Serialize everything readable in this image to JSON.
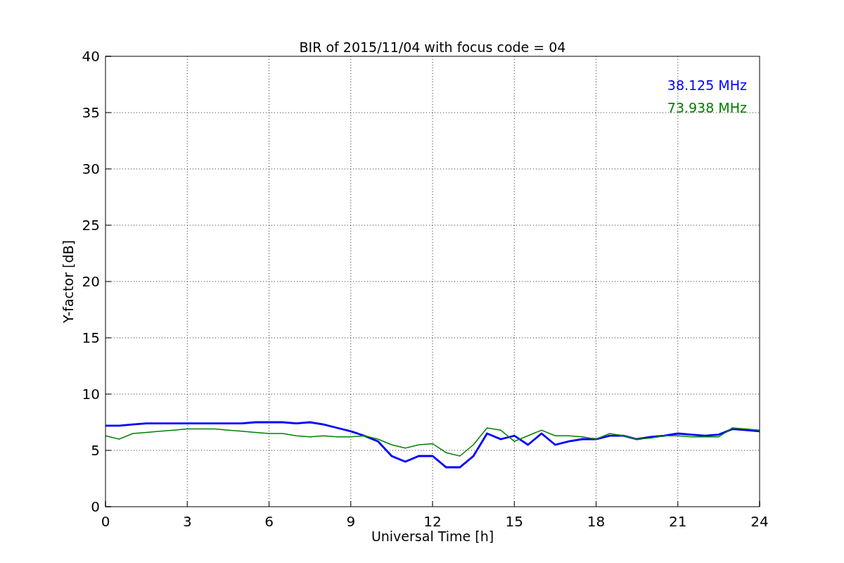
{
  "chart_data": {
    "type": "line",
    "title": "BIR of 2015/11/04 with focus code = 04",
    "xlabel": "Universal Time [h]",
    "ylabel": "Y-factor [dB]",
    "x": [
      0,
      0.5,
      1,
      1.5,
      2,
      2.5,
      3,
      3.5,
      4,
      4.5,
      5,
      5.5,
      6,
      6.5,
      7,
      7.5,
      8,
      8.5,
      9,
      9.5,
      10,
      10.5,
      11,
      11.5,
      12,
      12.5,
      13,
      13.5,
      14,
      14.5,
      15,
      15.5,
      16,
      16.5,
      17,
      17.5,
      18,
      18.5,
      19,
      19.5,
      20,
      20.5,
      21,
      21.5,
      22,
      22.5,
      23,
      23.5,
      24
    ],
    "series": [
      {
        "name": "38.125 MHz",
        "color": "#0000ff",
        "values": [
          7.2,
          7.2,
          7.3,
          7.4,
          7.4,
          7.4,
          7.4,
          7.4,
          7.4,
          7.4,
          7.4,
          7.5,
          7.5,
          7.5,
          7.4,
          7.5,
          7.3,
          7.0,
          6.7,
          6.3,
          5.8,
          4.5,
          4.0,
          4.5,
          4.5,
          3.5,
          3.5,
          4.5,
          6.5,
          6.0,
          6.3,
          5.5,
          6.5,
          5.5,
          5.8,
          6.0,
          6.0,
          6.3,
          6.3,
          6.0,
          6.2,
          6.3,
          6.5,
          6.4,
          6.3,
          6.4,
          6.9,
          6.8,
          6.7
        ]
      },
      {
        "name": "73.938 MHz",
        "color": "#008000",
        "values": [
          6.3,
          6.0,
          6.5,
          6.6,
          6.7,
          6.8,
          6.9,
          6.9,
          6.9,
          6.8,
          6.7,
          6.6,
          6.5,
          6.5,
          6.3,
          6.2,
          6.3,
          6.2,
          6.2,
          6.3,
          6.0,
          5.5,
          5.2,
          5.5,
          5.6,
          4.8,
          4.5,
          5.5,
          7.0,
          6.8,
          5.8,
          6.3,
          6.8,
          6.3,
          6.3,
          6.2,
          6.0,
          6.5,
          6.3,
          6.0,
          6.1,
          6.3,
          6.3,
          6.2,
          6.2,
          6.2,
          7.0,
          6.9,
          6.8
        ]
      }
    ],
    "xlim": [
      0,
      24
    ],
    "ylim": [
      0,
      40
    ],
    "xticks": [
      0,
      3,
      6,
      9,
      12,
      15,
      18,
      21,
      24
    ],
    "yticks": [
      0,
      5,
      10,
      15,
      20,
      25,
      30,
      35,
      40
    ],
    "grid": true
  }
}
